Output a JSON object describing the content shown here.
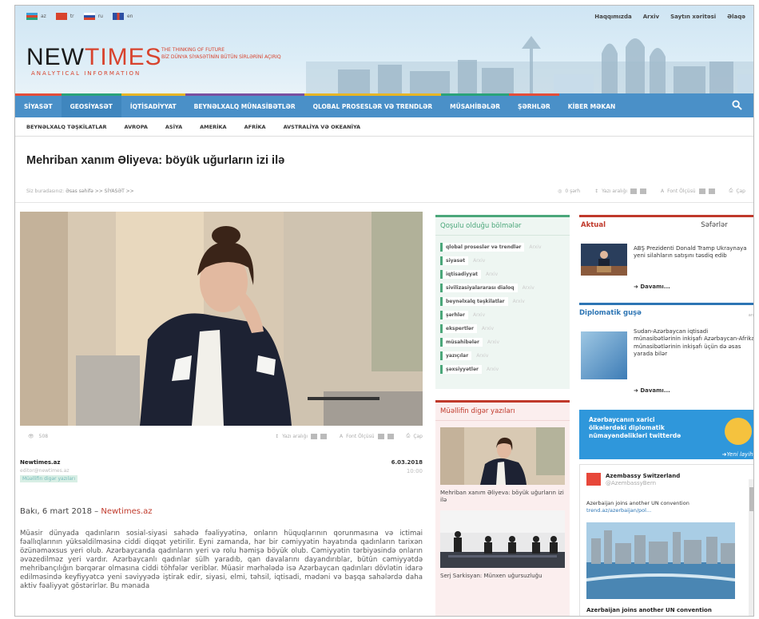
{
  "languages": [
    {
      "code": "az",
      "label": "az"
    },
    {
      "code": "tr",
      "label": "tr"
    },
    {
      "code": "ru",
      "label": "ru"
    },
    {
      "code": "en",
      "label": "en"
    }
  ],
  "toplinks": [
    "Haqqımızda",
    "Arxiv",
    "Saytın xəritəsi",
    "Əlaqə"
  ],
  "logo": {
    "main": "NEW",
    "accent": "TIMES",
    "sub": "ANALYTICAL INFORMATION"
  },
  "tagline": [
    "THE THINKING OF FUTURE",
    "BİZ DÜNYA SİYASƏTİNİN BÜTÜN SİRLƏRİNİ AÇIRIQ"
  ],
  "nav": [
    "SİYASƏT",
    "GEOSİYASƏT",
    "İQTİSADİYYAT",
    "BEYNƏLXALQ MÜNASİBƏTLƏR",
    "QLOBAL PROSESLƏR VƏ TRENDLƏR",
    "MÜSAHİBƏLƏR",
    "ŞƏRHLƏR",
    "KİBER MƏKAN"
  ],
  "subnav": [
    "BEYNƏLXALQ TƏŞKİLATLAR",
    "AVROPA",
    "ASİYA",
    "AMERİKA",
    "AFRİKA",
    "AVSTRALİYA VƏ OKEANİYA"
  ],
  "article": {
    "title": "Mehriban xanım Əliyeva: böyük uğurların izi ilə",
    "breadcrumb_prefix": "Siz buradasınız:",
    "breadcrumb": "Əsas səhifə >> SİYASƏT >>",
    "tools": {
      "like": "0 şərh",
      "font": "Yazı aralığı",
      "size": "Font Ölçüsü",
      "print": "Çap"
    },
    "views": "508",
    "author_name": "Newtimes.az",
    "author_mail": "editor@newtimes.az",
    "author_tag": "Müəllifin digər yazıları",
    "date": "6.03.2018",
    "time": "10:00",
    "dateline": "Bakı, 6 mart 2018 – ",
    "dateline_source": "Newtimes.az",
    "body": "Müasir dünyada qadınların sosial-siyasi sahədə fəaliyyətinə, onların hüquqlarının qorunmasına və ictimai fəallıqlarının yüksəldilməsinə ciddi diqqət yetirilir. Eyni zamanda, hər bir cəmiyyətin həyatında qadınların tarixən özünəməxsus yeri olub. Azərbaycanda qadınların yeri və rolu həmişə böyük olub. Cəmiyyətin tərbiyəsində onların əvəzedilməz yeri vardır. Azərbaycanlı qadınlar sülh yaradıb, qan davalarını dayandırıblar, bütün cəmiyyətdə mehribançılığın bərqərar olmasına ciddi töhfələr veriblər. Müasir mərhələdə isə Azərbaycan qadınları dövlətin idarə edilməsində keyfiyyətcə yeni səviyyədə iştirak edir, siyasi, elmi, təhsil, iqtisadi, mədəni və başqa sahələrdə daha aktiv fəaliyyət göstərirlər. Bu mənada"
  },
  "sections": {
    "title": "Qoşulu olduğu bölmələr",
    "items": [
      {
        "label": "qlobal proseslər və trendlər",
        "sub": "Arxiv"
      },
      {
        "label": "siyasət",
        "sub": "Arxiv"
      },
      {
        "label": "iqtisadiyyat",
        "sub": "Arxiv"
      },
      {
        "label": "sivilizasiyalararası dialoq",
        "sub": "Arxiv"
      },
      {
        "label": "beynəlxalq təşkilatlar",
        "sub": "Arxiv"
      },
      {
        "label": "şərhlər",
        "sub": "Arxiv"
      },
      {
        "label": "ekspertlər",
        "sub": "Arxiv"
      },
      {
        "label": "müsahibələr",
        "sub": "Arxiv"
      },
      {
        "label": "yazıçılar",
        "sub": "Arxiv"
      },
      {
        "label": "şəxsiyyətlər",
        "sub": "Arxiv"
      }
    ]
  },
  "other_posts": {
    "title": "Müəllifin digər yazıları",
    "items": [
      {
        "caption": "Mehriban xanım Əliyeva: böyük uğurların izi ilə"
      },
      {
        "caption": "Serj Sarkisyan: Münxen uğursuzluğu"
      }
    ]
  },
  "right": {
    "tab_active": "Aktual",
    "tab_other": "Səfərlər",
    "news_text": "ABŞ Prezidenti Donald Tramp Ukraynaya yeni silahların satışını təsdiq edib",
    "more": "Davamı...",
    "dip_title": "Diplomatik guşə",
    "dip_archive": "arxiv",
    "dip_text": "Sudan-Azərbaycan iqtisadi münasibətlərinin inkişafı Azərbaycan-Afrika münasibətlərinin inkişafı üçün də əsas yarada bilər",
    "banner": [
      "Azərbaycanın xarici",
      "ölkələrdəki diplomatik",
      "nümayəndəlikləri twitterdə"
    ],
    "banner_new": "Yeni layiha",
    "tweet_name": "Azembassy Switzerland",
    "tweet_handle": "@AzembassyBern",
    "tweet_text": "Azerbaijan joins another UN convention ",
    "tweet_link": "trend.az/azerbaijan/pol...",
    "tweet_footer": "Azerbaijan joins another UN convention"
  }
}
